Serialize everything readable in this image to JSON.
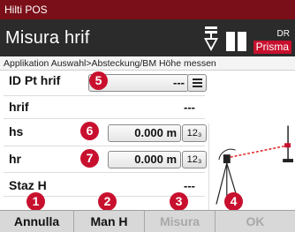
{
  "app_title": "Hilti POS",
  "header": {
    "title": "Misura hrif",
    "mode_top": "DR",
    "mode_bottom": "Prisma"
  },
  "breadcrumb": "Applikation Auswahl>Absteckung/BM Höhe messen",
  "fields": [
    {
      "label": "ID Pt hrif",
      "value": "---"
    },
    {
      "label": "hrif",
      "value": "---"
    },
    {
      "label": "hs",
      "value": "0.000 m"
    },
    {
      "label": "hr",
      "value": "0.000 m"
    },
    {
      "label": "Staz H",
      "value": "---"
    }
  ],
  "numeric_button": "12₃",
  "softkeys": [
    {
      "label": "Annulla",
      "enabled": true
    },
    {
      "label": "Man H",
      "enabled": true
    },
    {
      "label": "Misura",
      "enabled": false
    },
    {
      "label": "OK",
      "enabled": false
    }
  ],
  "callouts": [
    "1",
    "2",
    "3",
    "4",
    "5",
    "6",
    "7"
  ],
  "colors": {
    "app_bar": "#7a0f19",
    "header": "#2b2b2b",
    "accent_red": "#c8102e",
    "softkey_bar": "#d8d8d8"
  },
  "icons": [
    "plumb-bob-icon",
    "battery-icon",
    "prism-mode-icon",
    "list-icon",
    "numeric-keypad-icon",
    "tripod-instrument-icon",
    "target-staff-icon"
  ]
}
